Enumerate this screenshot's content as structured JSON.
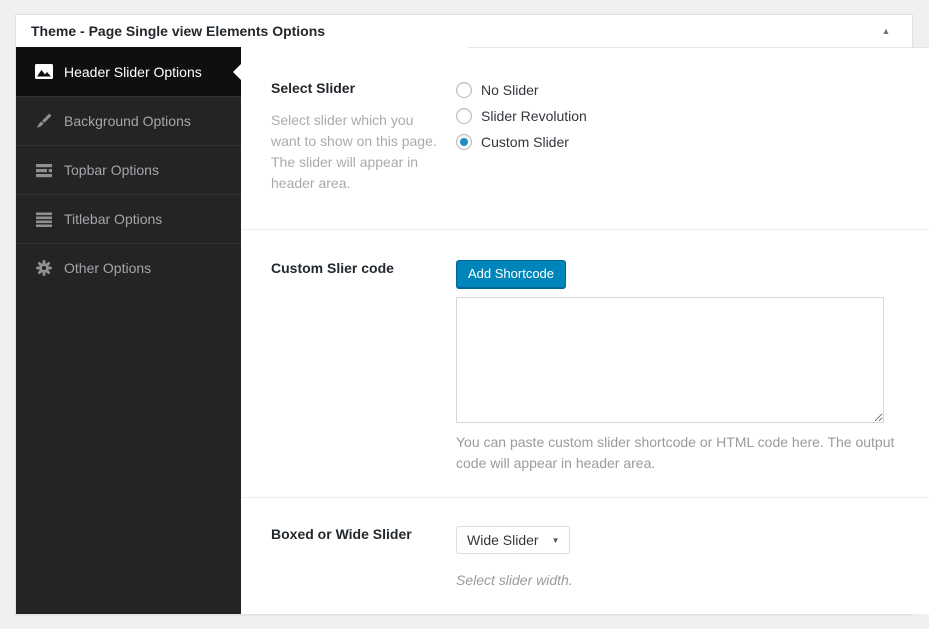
{
  "metabox": {
    "title": "Theme - Page Single view Elements Options",
    "toggle_icon": "collapse-up-arrow",
    "toggle_glyph": "▲"
  },
  "sidebar": {
    "tabs": [
      {
        "label": "Header Slider Options",
        "icon": "image-icon",
        "active": true
      },
      {
        "label": "Background Options",
        "icon": "brush-icon",
        "active": false
      },
      {
        "label": "Topbar Options",
        "icon": "topbar-lines-icon",
        "active": false
      },
      {
        "label": "Titlebar Options",
        "icon": "titlebar-lines-icon",
        "active": false
      },
      {
        "label": "Other Options",
        "icon": "gear-icon",
        "active": false
      }
    ]
  },
  "content": {
    "select_slider": {
      "label": "Select Slider",
      "description": "Select slider which you want to show on this page. The slider will appear in header area.",
      "options": [
        {
          "label": "No Slider",
          "checked": false
        },
        {
          "label": "Slider Revolution",
          "checked": false
        },
        {
          "label": "Custom Slider",
          "checked": true
        }
      ]
    },
    "custom_slider": {
      "label": "Custom Slier code",
      "button_label": "Add Shortcode",
      "textarea_value": "",
      "help": "You can paste custom slider shortcode or HTML code here. The output code will appear in header area."
    },
    "boxed_wide": {
      "label": "Boxed or Wide Slider",
      "select_value": "Wide Slider",
      "select_caret": "▼",
      "caption": "Select slider width."
    }
  },
  "colors": {
    "page_bg": "#f0f0f1",
    "sidebar_bg": "#242424",
    "active_tab_bg": "#0f0f0f",
    "primary_button": "#0085ba",
    "radio_checked": "#1e8cbe",
    "divider": "#eeeeee"
  }
}
